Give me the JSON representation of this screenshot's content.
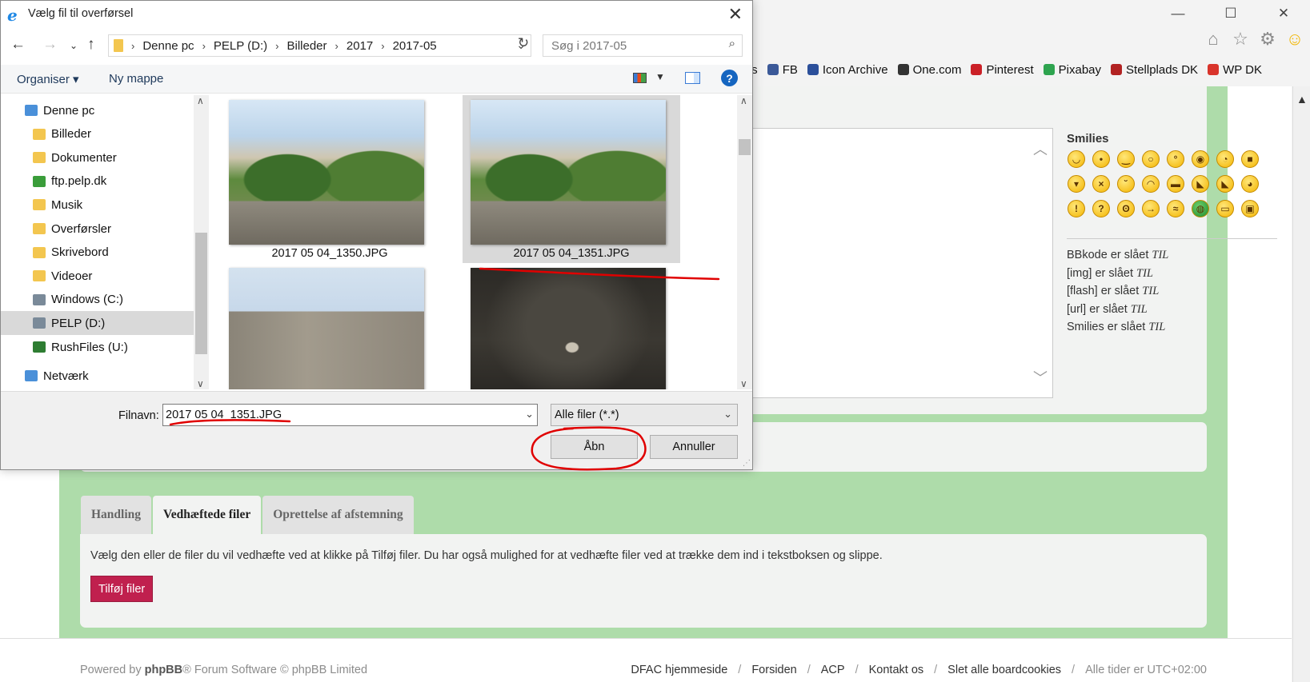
{
  "browser": {
    "window_controls": [
      "—",
      "☐",
      "✕"
    ],
    "nav_icons": [
      "home-icon",
      "star-icon",
      "gear-icon",
      "smiley-icon"
    ],
    "favorites": [
      {
        "label": "e-Boks",
        "icon": "eboks-icon",
        "color": "#1b3f6e"
      },
      {
        "label": "FB",
        "icon": "facebook-icon",
        "color": "#3b5998"
      },
      {
        "label": "Icon Archive",
        "icon": "icon-archive-icon",
        "color": "#2b4f9a"
      },
      {
        "label": "One.com",
        "icon": "onecom-icon",
        "color": "#333333"
      },
      {
        "label": "Pinterest",
        "icon": "pinterest-icon",
        "color": "#cb2027"
      },
      {
        "label": "Pixabay",
        "icon": "pixabay-icon",
        "color": "#2ea44f"
      },
      {
        "label": "Stellplads DK",
        "icon": "stellplads-icon",
        "color": "#b22222"
      },
      {
        "label": "WP DK",
        "icon": "wordpress-icon",
        "color": "#d9342b"
      }
    ]
  },
  "forum": {
    "smilies_title": "Smilies",
    "bbcode": [
      {
        "label": "BBkode er slået",
        "state": "TIL"
      },
      {
        "label": "[img] er slået",
        "state": "TIL"
      },
      {
        "label": "[flash] er slået",
        "state": "TIL"
      },
      {
        "label": "[url] er slået",
        "state": "TIL"
      },
      {
        "label": "Smilies er slået",
        "state": "TIL"
      }
    ],
    "tabs": [
      "Handling",
      "Vedhæftede filer",
      "Oprettelse af afstemning"
    ],
    "active_tab": "Vedhæftede filer",
    "attach_text": "Vælg den eller de filer du vil vedhæfte ved at klikke på Tilføj filer. Du har også mulighed for at vedhæfte filer ved at trække dem ind i tekstboksen og slippe.",
    "add_files_label": "Tilføj filer",
    "footer_powered_prefix": "Powered by",
    "footer_powered_brand": "phpBB",
    "footer_powered_suffix": "® Forum Software © phpBB Limited",
    "footer_links": [
      "DFAC hjemmeside",
      "Forsiden",
      "ACP",
      "Kontakt os",
      "Slet alle boardcookies"
    ],
    "footer_timezone": "Alle tider er UTC+02:00"
  },
  "dialog": {
    "title": "Vælg fil til overførsel",
    "breadcrumb": [
      "Denne pc",
      "PELP (D:)",
      "Billeder",
      "2017",
      "2017-05"
    ],
    "search_placeholder": "Søg i 2017-05",
    "toolbar": {
      "organise": "Organiser ▾",
      "new_folder": "Ny mappe"
    },
    "tree": [
      {
        "label": "Denne pc",
        "icon": "computer-icon",
        "color": "#4a90d9",
        "indent": 1
      },
      {
        "label": "Billeder",
        "icon": "pictures-folder-icon",
        "color": "#f3c64f",
        "indent": 2
      },
      {
        "label": "Dokumenter",
        "icon": "documents-folder-icon",
        "color": "#f3c64f",
        "indent": 2
      },
      {
        "label": "ftp.pelp.dk",
        "icon": "network-location-icon",
        "color": "#3a9d3a",
        "indent": 2
      },
      {
        "label": "Musik",
        "icon": "music-folder-icon",
        "color": "#f3c64f",
        "indent": 2
      },
      {
        "label": "Overførsler",
        "icon": "downloads-folder-icon",
        "color": "#f3c64f",
        "indent": 2
      },
      {
        "label": "Skrivebord",
        "icon": "desktop-folder-icon",
        "color": "#f3c64f",
        "indent": 2
      },
      {
        "label": "Videoer",
        "icon": "videos-folder-icon",
        "color": "#f3c64f",
        "indent": 2
      },
      {
        "label": "Windows (C:)",
        "icon": "drive-icon",
        "color": "#7a8a99",
        "indent": 2
      },
      {
        "label": "PELP (D:)",
        "icon": "drive-icon",
        "color": "#7a8a99",
        "indent": 2
      },
      {
        "label": "RushFiles (U:)",
        "icon": "network-drive-icon",
        "color": "#2e7d32",
        "indent": 2
      },
      {
        "label": "Netværk",
        "icon": "network-icon",
        "color": "#4a90d9",
        "indent": 1
      }
    ],
    "selected_tree": "PELP (D:)",
    "files": [
      {
        "name": "2017 05 04_1350.JPG",
        "kind": "land"
      },
      {
        "name": "2017 05 04_1351.JPG",
        "kind": "land"
      },
      {
        "name": "",
        "kind": "church"
      },
      {
        "name": "",
        "kind": "interior"
      }
    ],
    "selected_file": "2017 05 04_1351.JPG",
    "filename_label": "Filnavn:",
    "filename_value": "2017 05 04_1351.JPG",
    "filter_value": "Alle filer (*.*)",
    "open_label": "Åbn",
    "cancel_label": "Annuller"
  },
  "annotation_color": "#e00000"
}
